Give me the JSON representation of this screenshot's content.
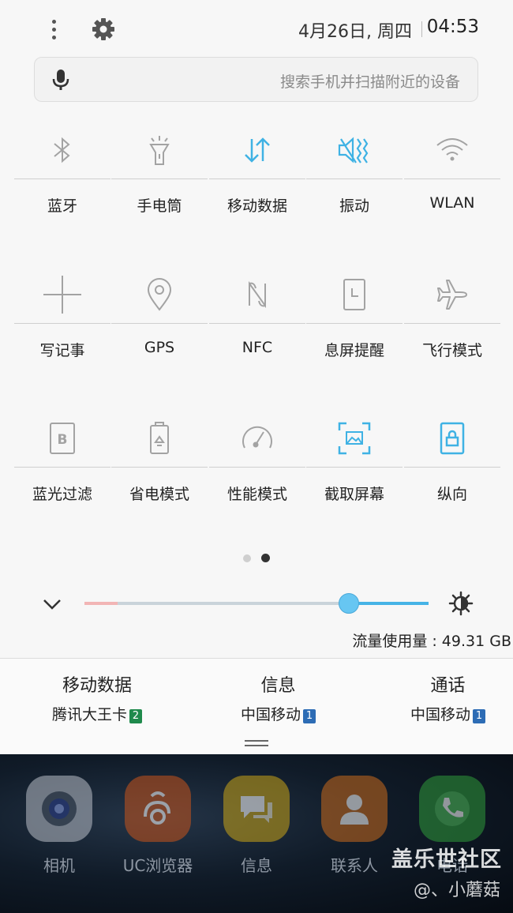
{
  "status": {
    "date": "4月26日, 周四",
    "time": "04:53"
  },
  "search": {
    "placeholder": "搜索手机并扫描附近的设备"
  },
  "tiles": [
    {
      "label": "蓝牙",
      "icon": "bluetooth-icon",
      "active": false
    },
    {
      "label": "手电筒",
      "icon": "flashlight-icon",
      "active": false
    },
    {
      "label": "移动数据",
      "icon": "mobile-data-icon",
      "active": true
    },
    {
      "label": "振动",
      "icon": "vibrate-icon",
      "active": true
    },
    {
      "label": "WLAN",
      "icon": "wifi-icon",
      "active": false
    },
    {
      "label": "写记事",
      "icon": "plus-icon",
      "active": false
    },
    {
      "label": "GPS",
      "icon": "location-pin-icon",
      "active": false
    },
    {
      "label": "NFC",
      "icon": "nfc-icon",
      "active": false
    },
    {
      "label": "息屏提醒",
      "icon": "always-on-display-icon",
      "active": false
    },
    {
      "label": "飞行模式",
      "icon": "airplane-icon",
      "active": false
    },
    {
      "label": "蓝光过滤",
      "icon": "blue-light-filter-icon",
      "active": false
    },
    {
      "label": "省电模式",
      "icon": "battery-saver-icon",
      "active": false
    },
    {
      "label": "性能模式",
      "icon": "speedometer-icon",
      "active": false
    },
    {
      "label": "截取屏幕",
      "icon": "screenshot-icon",
      "active": true
    },
    {
      "label": "纵向",
      "icon": "portrait-lock-icon",
      "active": true
    }
  ],
  "pager": {
    "pages": 2,
    "current": 2
  },
  "brightness": {
    "level": 0.77
  },
  "usage": {
    "text": "流量使用量 : 49.31 GB"
  },
  "sims": [
    {
      "title": "移动数据",
      "carrier": "腾讯大王卡",
      "badge": "2",
      "badge_color": "#1f8a4c"
    },
    {
      "title": "信息",
      "carrier": "中国移动",
      "badge": "1",
      "badge_color": "#2d6cb5"
    },
    {
      "title": "通话",
      "carrier": "中国移动",
      "badge": "1",
      "badge_color": "#2d6cb5"
    }
  ],
  "apps": [
    {
      "name": "相机",
      "icon": "camera-icon",
      "color": "#b9bec7"
    },
    {
      "name": "UC浏览器",
      "icon": "uc-browser-icon",
      "color": "#c8541b"
    },
    {
      "name": "信息",
      "icon": "messages-icon",
      "color": "#c9a417"
    },
    {
      "name": "联系人",
      "icon": "contacts-icon",
      "color": "#c96a1c"
    },
    {
      "name": "电话",
      "icon": "phone-icon",
      "color": "#2f9a3a"
    }
  ],
  "watermark": {
    "site": "盖乐世社区",
    "user": "@、小蘑菇"
  },
  "colors": {
    "accent": "#3fb2e4",
    "inactive": "#9b9b9b"
  }
}
